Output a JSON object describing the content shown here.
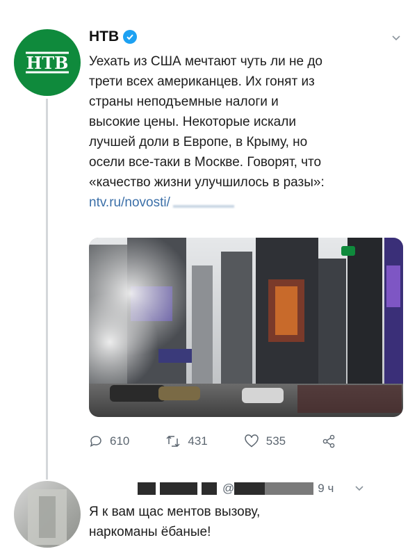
{
  "tweet": {
    "author": "НТВ",
    "verified": true,
    "text_lines": [
      "Уехать из США мечтают чуть ли не до",
      "трети всех американцев. Их гонят из",
      "страны неподъемные налоги и",
      "высокие цены. Некоторые искали",
      "лучшей доли в Европе, в Крыму, но",
      "осели все-таки в Москве. Говорят, что",
      "«качество жизни улучшилось в разы»:"
    ],
    "link": "ntv.ru/novosti/",
    "media_icon": "times-square-photo",
    "stats": {
      "replies": "610",
      "retweets": "431",
      "likes": "535"
    }
  },
  "reply": {
    "handle_prefix": "@",
    "time": "9 ч",
    "text_lines": [
      "Я к вам щас ментов вызову,",
      "наркоманы ёбаные!"
    ]
  },
  "colors": {
    "ntv_green": "#0f8a3c",
    "verified_blue": "#1da1f2",
    "link_blue": "#3b6fa8",
    "meta_gray": "#5c6670"
  }
}
